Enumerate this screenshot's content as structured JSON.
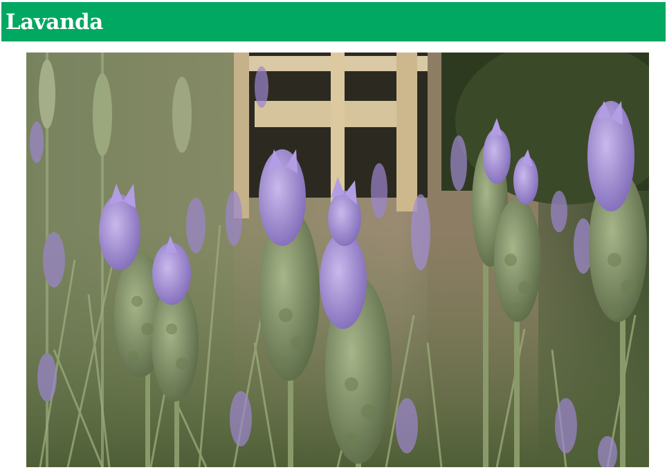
{
  "page": {
    "title": "Lavanda"
  },
  "colors": {
    "title_bar": "#00a861",
    "title_text": "#ffffff",
    "lavender": "#9c86cf",
    "stem": "#8a9a6a"
  },
  "photo": {
    "subject": "lavender-flowers-photo",
    "icon": "lavender-photo-image"
  }
}
